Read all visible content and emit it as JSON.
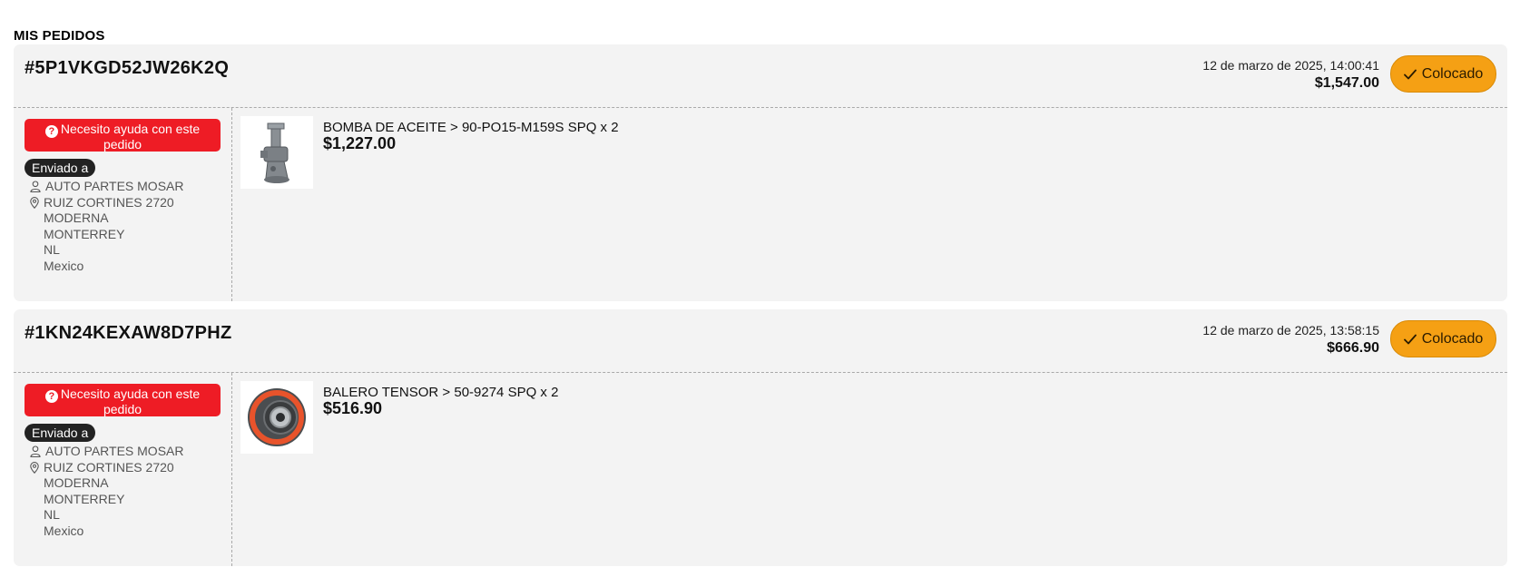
{
  "page": {
    "title": "MIS PEDIDOS"
  },
  "colors": {
    "status_orange": "#f5a014",
    "help_red": "#ee1c25",
    "card_bg": "#f3f3f3",
    "badge_dark": "#222222"
  },
  "icons": {
    "status": "check-icon",
    "help": "question-circle-icon",
    "person": "user-icon",
    "location": "map-pin-icon"
  },
  "orders": [
    {
      "id": "#5P1VKGD52JW26K2Q",
      "date": "12 de marzo de 2025, 14:00:41",
      "total": "$1,547.00",
      "status": "Colocado",
      "help_label": "Necesito ayuda con este pedido",
      "ship_label": "Enviado a",
      "address": {
        "name": "AUTO PARTES MOSAR",
        "street": "RUIZ CORTINES 2720",
        "neighborhood": "MODERNA",
        "city": "MONTERREY",
        "state": "NL",
        "country": "Mexico"
      },
      "items": [
        {
          "name": "BOMBA DE ACEITE > 90-PO15-M159S SPQ x 2",
          "price": "$1,227.00",
          "image": "oil-pump"
        }
      ]
    },
    {
      "id": "#1KN24KEXAW8D7PHZ",
      "date": "12 de marzo de 2025, 13:58:15",
      "total": "$666.90",
      "status": "Colocado",
      "help_label": "Necesito ayuda con este pedido",
      "ship_label": "Enviado a",
      "address": {
        "name": "AUTO PARTES MOSAR",
        "street": "RUIZ CORTINES 2720",
        "neighborhood": "MODERNA",
        "city": "MONTERREY",
        "state": "NL",
        "country": "Mexico"
      },
      "items": [
        {
          "name": "BALERO TENSOR > 50-9274 SPQ x 2",
          "price": "$516.90",
          "image": "tensioner-pulley"
        }
      ]
    }
  ]
}
